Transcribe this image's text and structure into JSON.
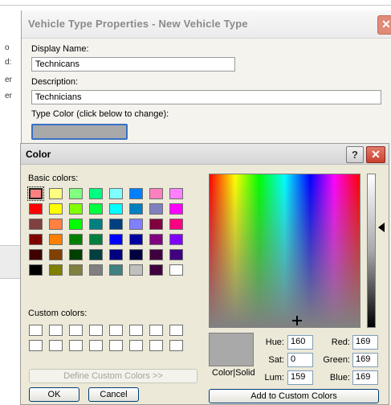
{
  "background_fragments": [
    "o",
    "d:",
    "er",
    "er"
  ],
  "vehicle_dialog": {
    "title": "Vehicle Type Properties - New Vehicle Type",
    "close_glyph": "✕",
    "display_name_label": "Display Name:",
    "display_name_value": "Technicans",
    "description_label": "Description:",
    "description_value": "Technicians",
    "type_color_label": "Type Color (click below to change):",
    "type_color": "#a9a9a9"
  },
  "color_dialog": {
    "title": "Color",
    "help_glyph": "?",
    "close_glyph": "✕",
    "basic_colors_label": "Basic colors:",
    "basic_colors": [
      "#ff8080",
      "#ffff80",
      "#80ff80",
      "#00ff80",
      "#80ffff",
      "#0080ff",
      "#ff80c0",
      "#ff80ff",
      "#ff0000",
      "#ffff00",
      "#80ff00",
      "#00ff40",
      "#00ffff",
      "#0080c0",
      "#8080c0",
      "#ff00ff",
      "#804040",
      "#ff8040",
      "#00ff00",
      "#008080",
      "#004080",
      "#8080ff",
      "#800040",
      "#ff0080",
      "#800000",
      "#ff8000",
      "#008000",
      "#008040",
      "#0000ff",
      "#0000a0",
      "#800080",
      "#8000ff",
      "#400000",
      "#804000",
      "#004000",
      "#004040",
      "#000080",
      "#000040",
      "#400040",
      "#400080",
      "#000000",
      "#808000",
      "#808040",
      "#808080",
      "#408080",
      "#c0c0c0",
      "#400040",
      "#ffffff"
    ],
    "custom_colors_label": "Custom colors:",
    "custom_colors": [
      "#ffffff",
      "#ffffff",
      "#ffffff",
      "#ffffff",
      "#ffffff",
      "#ffffff",
      "#ffffff",
      "#ffffff",
      "#ffffff",
      "#ffffff",
      "#ffffff",
      "#ffffff",
      "#ffffff",
      "#ffffff",
      "#ffffff",
      "#ffffff"
    ],
    "define_custom_label": "Define Custom Colors >>",
    "ok_label": "OK",
    "cancel_label": "Cancel",
    "color_solid_label": "Color|Solid",
    "preview_color": "#a9a9a9",
    "hue_label": "Hue:",
    "hue_value": "160",
    "sat_label": "Sat:",
    "sat_value": "0",
    "lum_label": "Lum:",
    "lum_value": "159",
    "red_label": "Red:",
    "red_value": "169",
    "green_label": "Green:",
    "green_value": "169",
    "blue_label": "Blue:",
    "blue_value": "169",
    "add_custom_label": "Add to Custom Colors"
  }
}
